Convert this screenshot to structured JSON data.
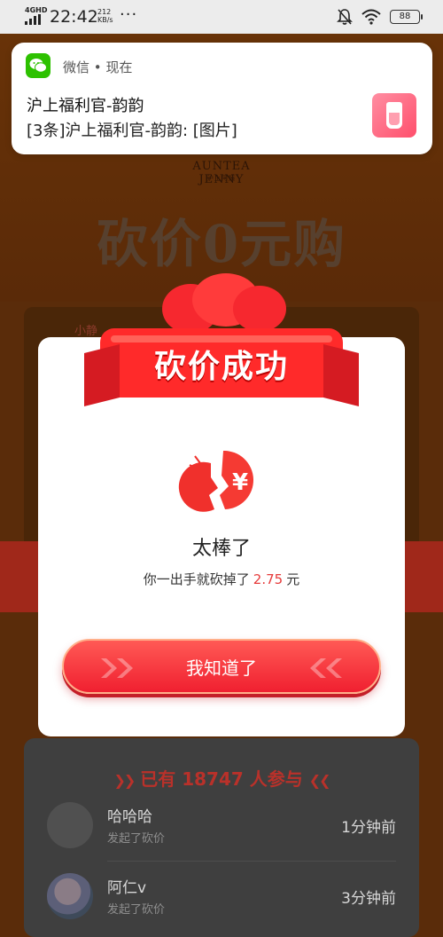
{
  "status_bar": {
    "network": "4GHD",
    "time": "22:42",
    "speed_value": "212",
    "speed_unit": "KB/s",
    "overflow": "···",
    "battery": "88"
  },
  "notification": {
    "app_name": "微信",
    "separator": "•",
    "time": "现在",
    "title": "沪上福利官-韵韵",
    "body": "[3条]沪上福利官-韵韵: [图片]"
  },
  "background": {
    "brand": "AUNTEA JENNY",
    "brand_sub": "沪上阿姨",
    "hero_title": "砍价0元购",
    "card_user": "小静",
    "participants_prefix": "已有",
    "participants_count": "18747",
    "participants_suffix": "人参与",
    "list": [
      {
        "name": "哈哈哈",
        "action": "发起了砍价",
        "time": "1分钟前"
      },
      {
        "name": "阿仁v",
        "action": "发起了砍价",
        "time": "3分钟前"
      }
    ]
  },
  "modal": {
    "banner": "砍价成功",
    "title": "太棒了",
    "msg_prefix": "你一出手就砍掉了",
    "amount": "2.75",
    "msg_suffix": "元",
    "button": "我知道了"
  },
  "colors": {
    "accent_red": "#f02030",
    "amount_red": "#e63a3a",
    "wechat_green": "#2dc100"
  }
}
